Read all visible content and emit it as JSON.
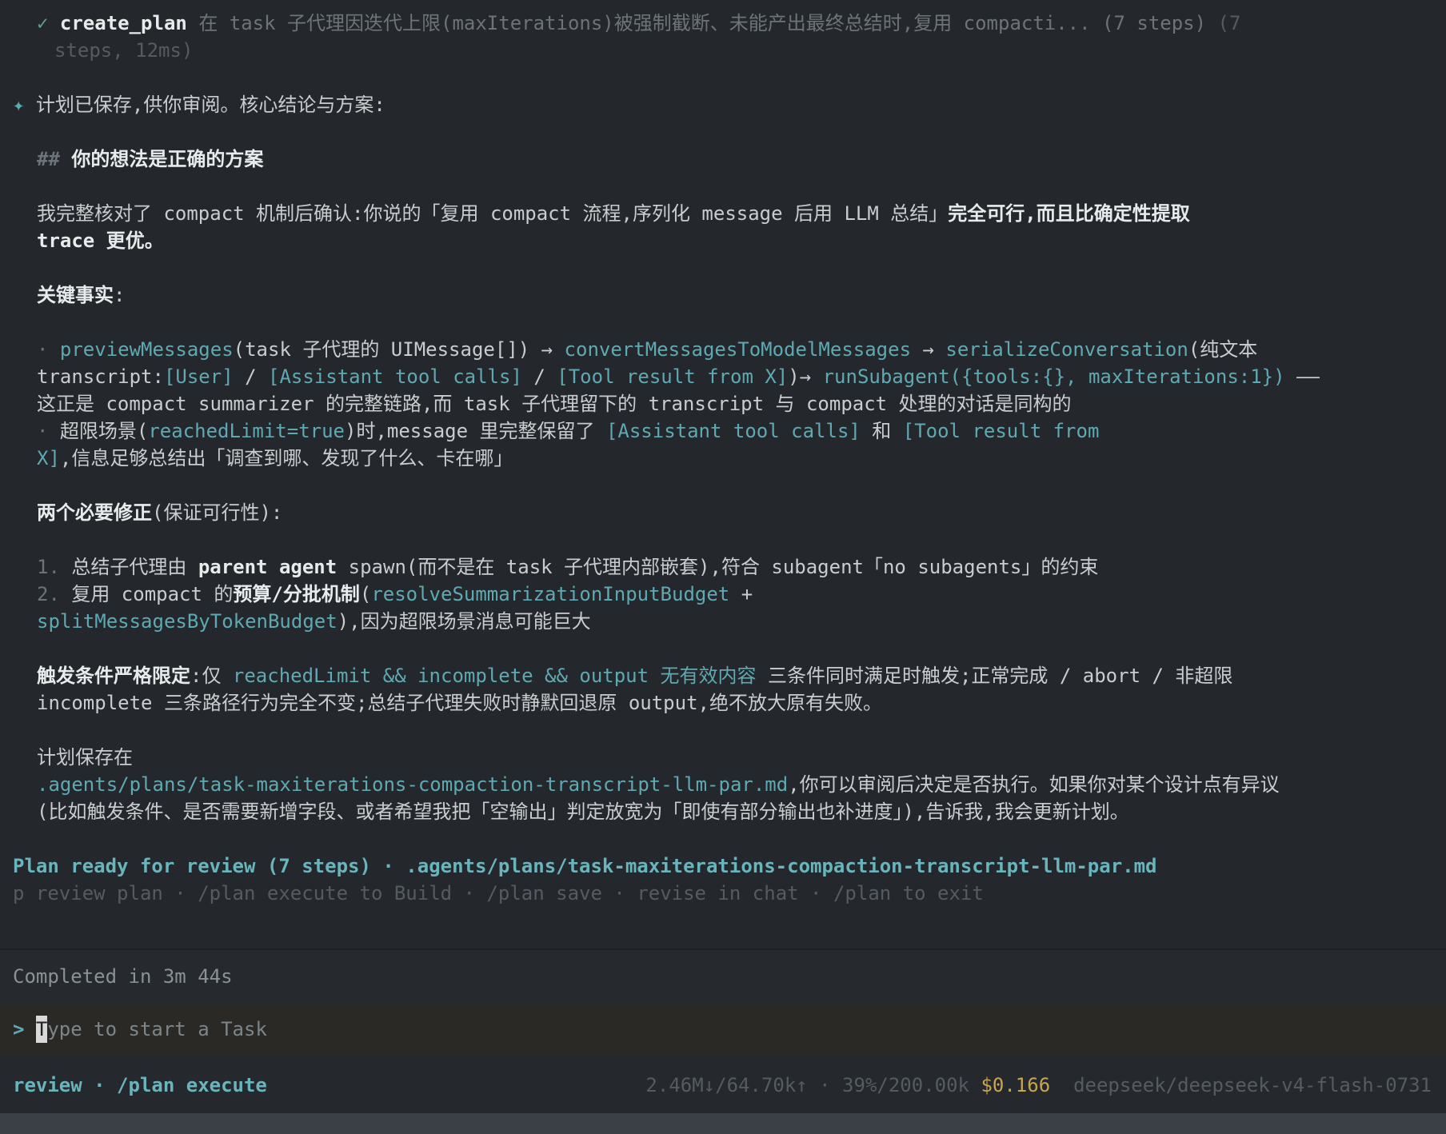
{
  "tool_call": {
    "icon": "check-icon",
    "name": "create_plan",
    "summary": "在 task 子代理因迭代上限(maxIterations)被强制截断、未能产出最终总结时,复用 compacti... (7 steps)",
    "summary_tail": "(7",
    "meta": "steps, 12ms)"
  },
  "message": {
    "icon": "sparkle-icon",
    "intro": "计划已保存,供你审阅。核心结论与方案:",
    "heading_marker": "##",
    "heading": "你的想法是正确的方案",
    "p1_a": "我完整核对了 compact 机制后确认:你说的「复用 compact 流程,序列化 message 后用 LLM 总结」",
    "p1_b": "完全可行,而且比确定性提取",
    "p1_c": "trace 更优。",
    "facts_label": "关键事实",
    "facts_colon": ":",
    "fact1": {
      "bullet": "·",
      "fn1": "previewMessages",
      "t1": "(task 子代理的 UIMessage[]) → ",
      "fn2": "convertMessagesToModelMessages",
      "t2": " → ",
      "fn3": "serializeConversation",
      "t3": "(纯文本",
      "t4": "transcript:",
      "c1": "[User]",
      "t5": " / ",
      "c2": "[Assistant tool calls]",
      "t6": " / ",
      "c3": "[Tool result from X]",
      "t7": ")→ ",
      "c4": "runSubagent({tools:{}, maxIterations:1})",
      "t8": " ——",
      "t9": "这正是 compact summarizer 的完整链路,而 task 子代理留下的 transcript 与 compact 处理的对话是同构的"
    },
    "fact2": {
      "bullet": "·",
      "t1": "超限场景(",
      "c1": "reachedLimit=true",
      "t2": ")时,message 里完整保留了 ",
      "c2": "[Assistant tool calls]",
      "t3": " 和 ",
      "c3": "[Tool result from",
      "c4": "X]",
      "t4": ",信息足够总结出「调查到哪、发现了什么、卡在哪」"
    },
    "fix_label": "两个必要修正",
    "fix_suffix": "(保证可行性):",
    "fix1": {
      "num": "1.",
      "t1": "总结子代理由 ",
      "b1": "parent agent",
      "t2": " spawn(而不是在 task 子代理内部嵌套),符合 subagent「no subagents」的约束"
    },
    "fix2": {
      "num": "2.",
      "t1": "复用 compact 的",
      "b1": "预算/分批机制",
      "t2": "(",
      "c1": "resolveSummarizationInputBudget",
      "t3": " +",
      "c2": "splitMessagesByTokenBudget",
      "t4": "),因为超限场景消息可能巨大"
    },
    "trigger_label": "触发条件严格限定",
    "trigger_t1": ":仅 ",
    "trigger_c1": "reachedLimit && incomplete && output 无有效内容",
    "trigger_t2": " 三条件同时满足时触发;正常完成 / abort / 非超限",
    "trigger_t3": "incomplete 三条路径行为完全不变;总结子代理失败时静默回退原 output,绝不放大原有失败。",
    "save_label": "计划保存在",
    "save_path": ".agents/plans/task-maxiterations-compaction-transcript-llm-par.md",
    "save_t1": ",你可以审阅后决定是否执行。如果你对某个设计点有异议",
    "save_t2": "(比如触发条件、是否需要新增字段、或者希望我把「空输出」判定放宽为「即使有部分输出也补进度」),告诉我,我会更新计划。"
  },
  "plan_ready": {
    "label": "Plan ready for review (7 steps)",
    "sep": " · ",
    "path": ".agents/plans/task-maxiterations-compaction-transcript-llm-par.md"
  },
  "plan_actions": {
    "review": "p review plan",
    "execute": "/plan execute to Build",
    "save": "/plan save",
    "revise": "revise in chat",
    "exit": "/plan to exit",
    "sep": " · "
  },
  "completed": "Completed in 3m 44s",
  "input": {
    "prompt": ">",
    "cursor_char": "T",
    "placeholder_rest": "ype to start a Task"
  },
  "status": {
    "mode": "review · /plan execute",
    "tokens": "2.46M↓/64.70k↑ · 39%/200.00k",
    "cost": "$0.166",
    "model": "deepseek/deepseek-v4-flash-0731"
  }
}
